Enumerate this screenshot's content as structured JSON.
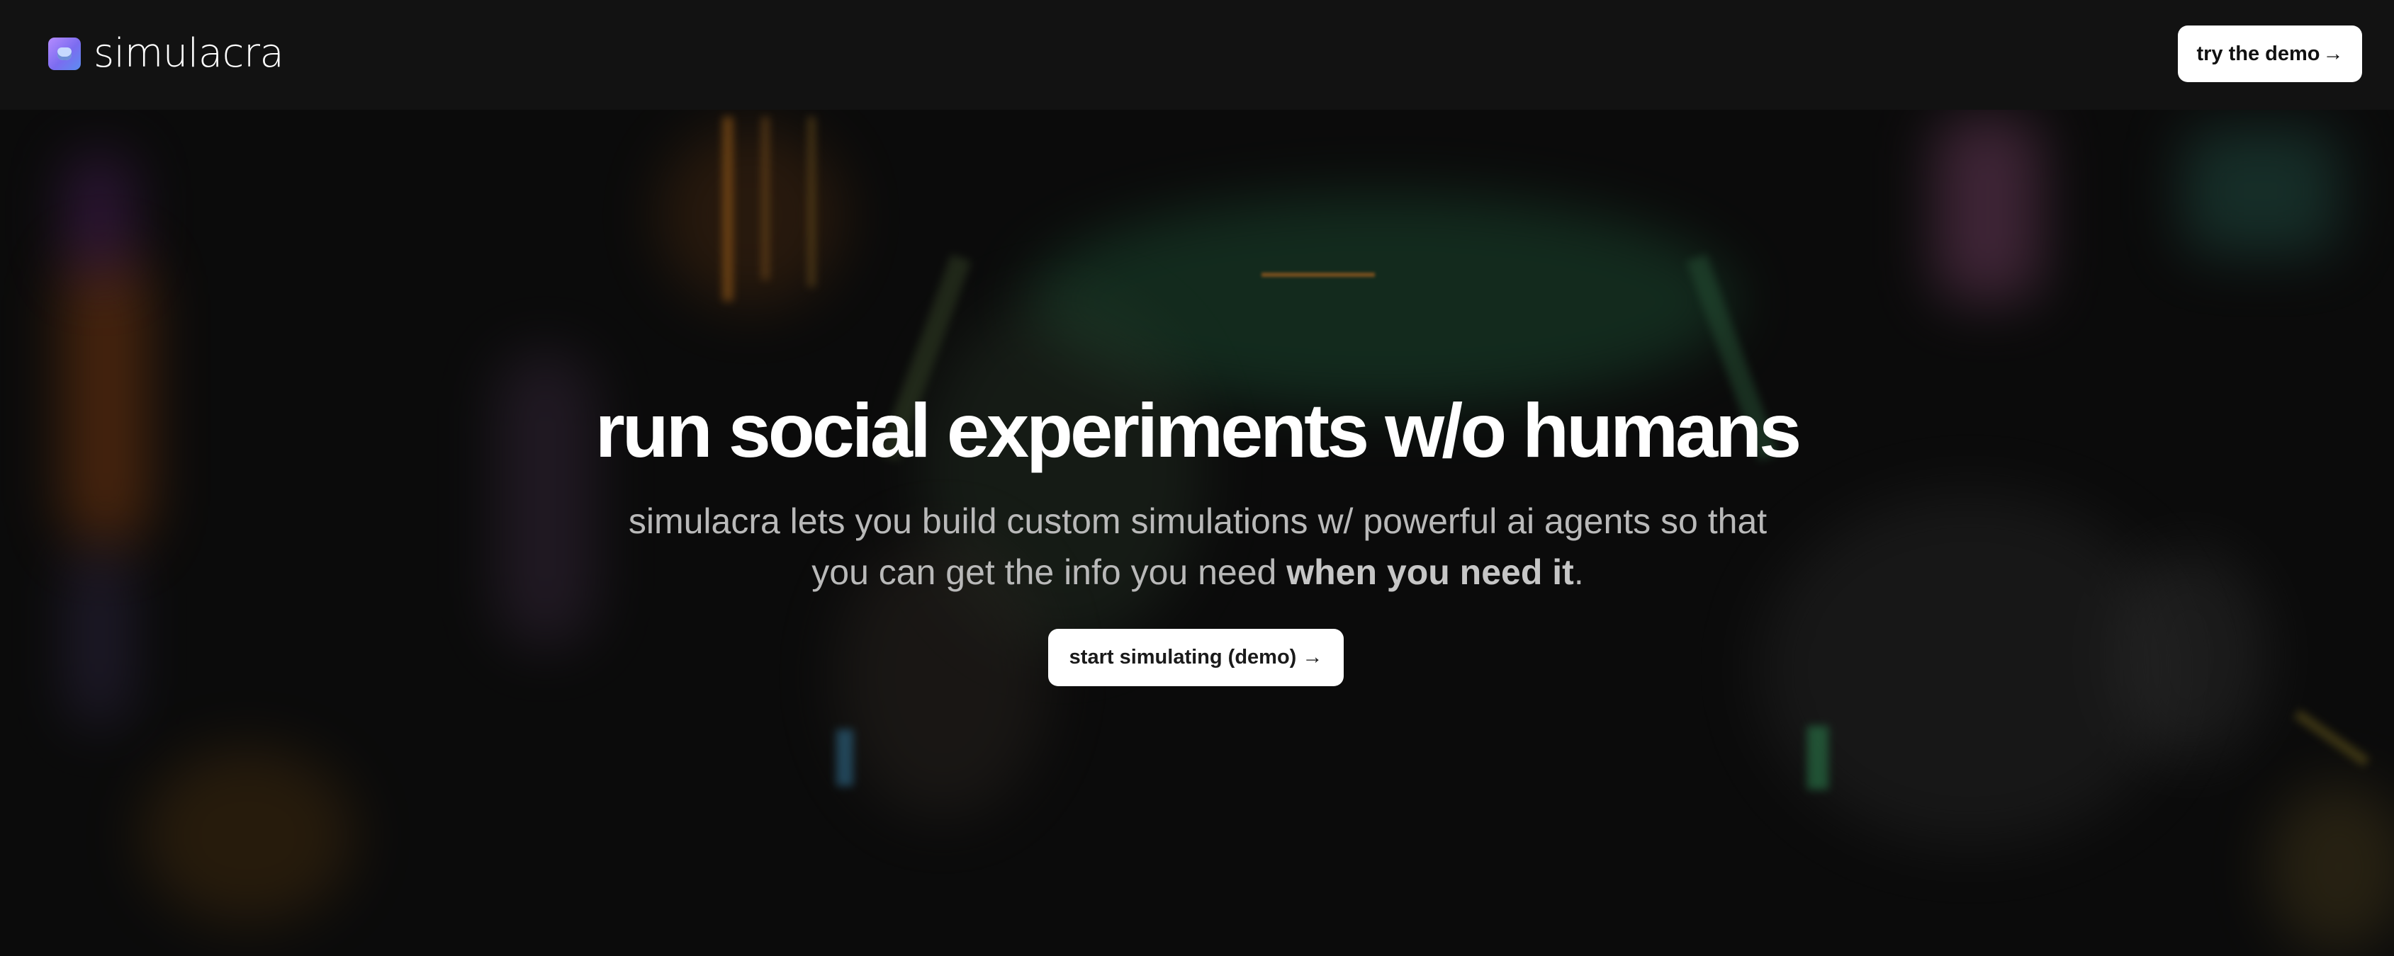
{
  "nav": {
    "brand_name": "simulacra",
    "logo_icon": "robot-face-icon",
    "cta_label": "try the demo",
    "cta_arrow": "→"
  },
  "hero": {
    "title": "run social experiments w/o humans",
    "subtitle_line_1": "simulacra lets you build custom simulations w/ powerful ai agents so that",
    "subtitle_line_2_prefix": "you can get the info you need ",
    "subtitle_line_2_bold": "when you need it",
    "subtitle_line_2_suffix": ".",
    "cta_label": "start simulating (demo)",
    "cta_arrow": "→"
  },
  "colors": {
    "background": "#0d0d0d",
    "topbar": "#121212",
    "button_bg": "#ffffff",
    "button_text": "#111111",
    "subtitle_text": "#b9b9b9"
  }
}
